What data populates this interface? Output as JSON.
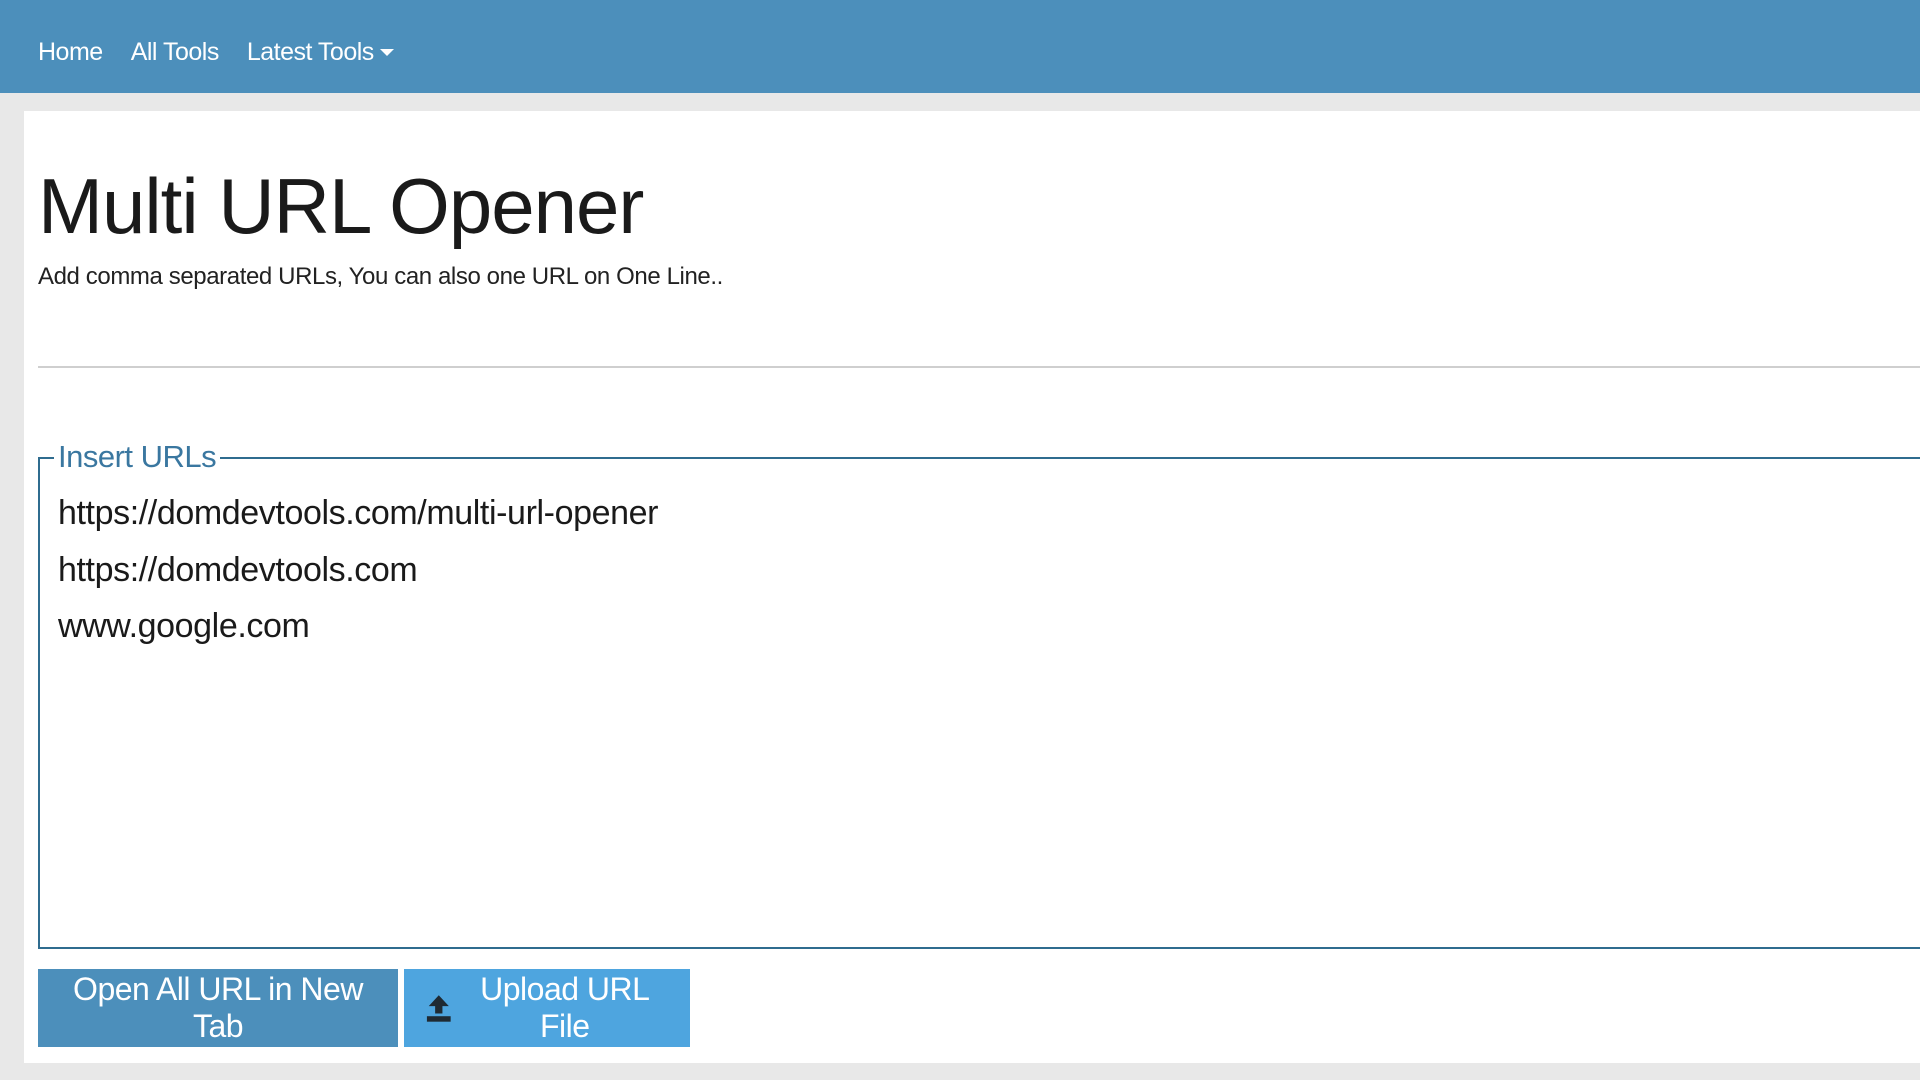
{
  "nav": {
    "home": "Home",
    "all_tools": "All Tools",
    "latest_tools": "Latest Tools"
  },
  "page": {
    "title": "Multi URL Opener",
    "subtitle": "Add comma separated URLs, You can also one URL on One Line.."
  },
  "url_form": {
    "legend": "Insert URLs",
    "value": "https://domdevtools.com/multi-url-opener\nhttps://domdevtools.com\nwww.google.com"
  },
  "buttons": {
    "open_all": "Open All URL in New Tab",
    "upload": "Upload URL File",
    "upload_icon": "upload-icon"
  },
  "colors": {
    "navbar": "#4c8fbb",
    "open_button": "#4c8fbb",
    "upload_button": "#4ea5df",
    "fieldset_border": "#2f6c8f"
  }
}
